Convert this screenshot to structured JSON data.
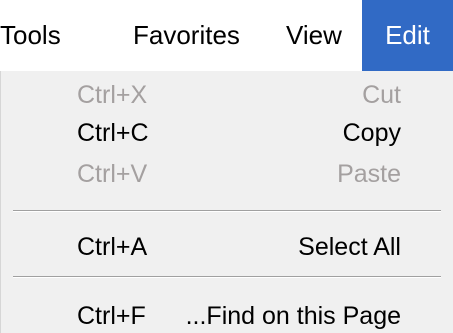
{
  "menubar": {
    "items": [
      {
        "label": "Tools"
      },
      {
        "label": "Favorites"
      },
      {
        "label": "View"
      },
      {
        "label": "Edit"
      }
    ]
  },
  "edit_menu": {
    "items": [
      {
        "shortcut": "Ctrl+X",
        "label": "Cut",
        "enabled": false
      },
      {
        "shortcut": "Ctrl+C",
        "label": "Copy",
        "enabled": true
      },
      {
        "shortcut": "Ctrl+V",
        "label": "Paste",
        "enabled": false
      },
      {
        "shortcut": "Ctrl+A",
        "label": "Select All",
        "enabled": true
      },
      {
        "shortcut": "Ctrl+F",
        "label": "...Find on this Page",
        "enabled": true
      }
    ]
  },
  "colors": {
    "highlight": "#316ac5",
    "highlight_text": "#ffffff",
    "disabled_text": "#a4a0a0",
    "menu_background": "#f0f0f0"
  }
}
